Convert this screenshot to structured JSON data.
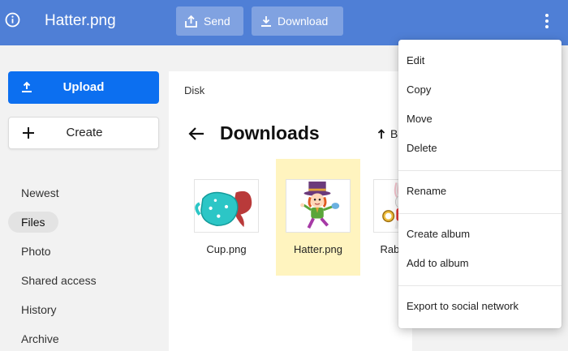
{
  "header": {
    "file_title": "Hatter.png",
    "send_label": "Send",
    "download_label": "Download",
    "accent_color": "#4f7fd6"
  },
  "sidebar": {
    "upload_label": "Upload",
    "create_label": "Create",
    "items": [
      {
        "label": "Newest"
      },
      {
        "label": "Files",
        "active": true
      },
      {
        "label": "Photo"
      },
      {
        "label": "Shared access"
      },
      {
        "label": "History"
      },
      {
        "label": "Archive"
      }
    ]
  },
  "main": {
    "breadcrumb": "Disk",
    "folder_title": "Downloads",
    "sort_label": "B",
    "files": [
      {
        "name": "Cup.png",
        "selected": false,
        "icon": "teacup-image"
      },
      {
        "name": "Hatter.png",
        "selected": true,
        "icon": "mad-hatter-image"
      },
      {
        "name": "Rabbit.png",
        "selected": false,
        "icon": "white-rabbit-image"
      }
    ]
  },
  "context_menu": {
    "items": [
      {
        "label": "Edit"
      },
      {
        "label": "Copy"
      },
      {
        "label": "Move"
      },
      {
        "label": "Delete"
      },
      {
        "label": "Rename"
      },
      {
        "label": "Create album"
      },
      {
        "label": "Add to album"
      },
      {
        "label": "Export to social network"
      }
    ]
  }
}
